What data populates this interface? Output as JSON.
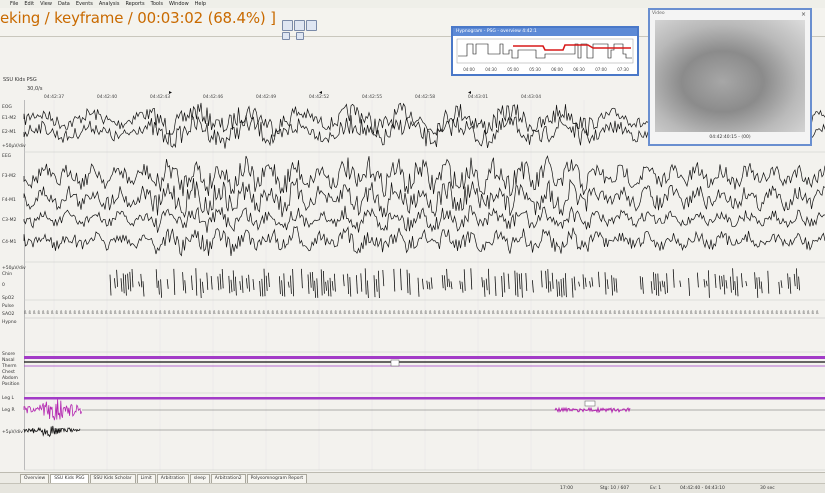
{
  "menu": [
    "File",
    "Edit",
    "View",
    "Data",
    "Events",
    "Analysis",
    "Reports",
    "Tools",
    "Window",
    "Help"
  ],
  "title_overlay": "eking / keyframe / 00:03:02 (68.4%) ]",
  "pane_title": "SSU Kids PSG",
  "speed": "30,0/s",
  "ruler_ticks": [
    "04:42:37",
    "04:42:40",
    "04:42:43",
    "04:42:46",
    "04:42:49",
    "04:42:52",
    "04:42:55",
    "04:42:58",
    "04:43:01",
    "04:43:04"
  ],
  "channels": {
    "eog_header": "EOG",
    "eog": [
      "E1-M2",
      "E2-M1"
    ],
    "eog_scale": "+50µV/div",
    "eeg_header": "EEG",
    "eeg": [
      "F3-M2",
      "F4-M1",
      "C3-M2",
      "C4-M1"
    ],
    "other": [
      "+50µV/div",
      "Chin",
      "0",
      "SpO2",
      "Pulse",
      "SAO2",
      "Hypno",
      "Snore",
      "Nasal",
      "Therm",
      "Chest",
      "Abdom",
      "Position",
      "Leg L",
      "Leg R",
      "+5µV/div"
    ]
  },
  "hypnogram": {
    "title": "Hypnogram - PSG - overview 4:42:1",
    "ticks": [
      "04:00",
      "04:30",
      "05:00",
      "05:30",
      "06:00",
      "06:30",
      "07:00",
      "07:30"
    ]
  },
  "video": {
    "title": "Video",
    "close": "×",
    "timestamp": "04:42:40:15 - (00)"
  },
  "tabs": [
    "Overview",
    "SSU Kids PSG",
    "SSU Kids Scholar",
    "Limit",
    "Arbitration",
    "sleep",
    "Arbitration2",
    "Polysomnogram Report"
  ],
  "active_tab": 1,
  "status": [
    "17:00",
    "Stg: 10 / 607",
    "Ev: 1",
    "04:42:40 - 04:43:10",
    "30 sec"
  ],
  "colors": {
    "purple": "#a23bc7",
    "red": "#d81a1a",
    "accent": "#4a78c8"
  }
}
